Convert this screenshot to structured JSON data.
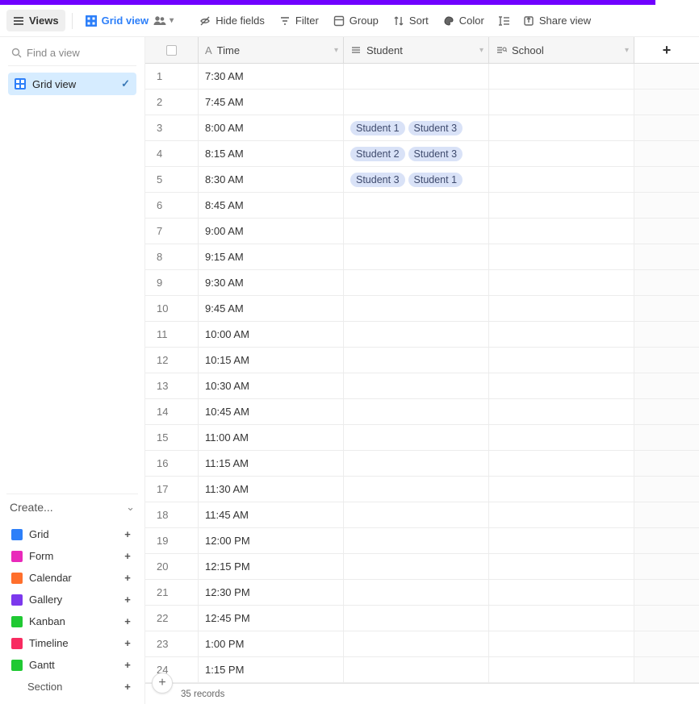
{
  "toolbar": {
    "views": "Views",
    "grid_view": "Grid view",
    "hide_fields": "Hide fields",
    "filter": "Filter",
    "group": "Group",
    "sort": "Sort",
    "color": "Color",
    "share": "Share view"
  },
  "sidebar": {
    "search_placeholder": "Find a view",
    "active_view": "Grid view",
    "create_label": "Create...",
    "view_types": {
      "grid": "Grid",
      "form": "Form",
      "calendar": "Calendar",
      "gallery": "Gallery",
      "kanban": "Kanban",
      "timeline": "Timeline",
      "gantt": "Gantt",
      "section": "Section"
    }
  },
  "columns": {
    "time": "Time",
    "student": "Student",
    "school": "School"
  },
  "rows": [
    {
      "n": 1,
      "time": "7:30 AM",
      "students": []
    },
    {
      "n": 2,
      "time": "7:45 AM",
      "students": []
    },
    {
      "n": 3,
      "time": "8:00 AM",
      "students": [
        "Student 1",
        "Student 3"
      ]
    },
    {
      "n": 4,
      "time": "8:15 AM",
      "students": [
        "Student 2",
        "Student 3"
      ]
    },
    {
      "n": 5,
      "time": "8:30 AM",
      "students": [
        "Student 3",
        "Student 1"
      ]
    },
    {
      "n": 6,
      "time": "8:45 AM",
      "students": []
    },
    {
      "n": 7,
      "time": "9:00 AM",
      "students": []
    },
    {
      "n": 8,
      "time": "9:15 AM",
      "students": []
    },
    {
      "n": 9,
      "time": "9:30 AM",
      "students": []
    },
    {
      "n": 10,
      "time": "9:45 AM",
      "students": []
    },
    {
      "n": 11,
      "time": "10:00 AM",
      "students": []
    },
    {
      "n": 12,
      "time": "10:15 AM",
      "students": []
    },
    {
      "n": 13,
      "time": "10:30 AM",
      "students": []
    },
    {
      "n": 14,
      "time": "10:45 AM",
      "students": []
    },
    {
      "n": 15,
      "time": "11:00 AM",
      "students": []
    },
    {
      "n": 16,
      "time": "11:15 AM",
      "students": []
    },
    {
      "n": 17,
      "time": "11:30 AM",
      "students": []
    },
    {
      "n": 18,
      "time": "11:45 AM",
      "students": []
    },
    {
      "n": 19,
      "time": "12:00 PM",
      "students": []
    },
    {
      "n": 20,
      "time": "12:15 PM",
      "students": []
    },
    {
      "n": 21,
      "time": "12:30 PM",
      "students": []
    },
    {
      "n": 22,
      "time": "12:45 PM",
      "students": []
    },
    {
      "n": 23,
      "time": "1:00 PM",
      "students": []
    },
    {
      "n": 24,
      "time": "1:15 PM",
      "students": []
    }
  ],
  "footer": {
    "record_count": "35 records"
  }
}
